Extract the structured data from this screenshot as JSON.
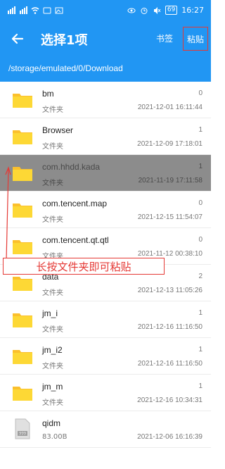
{
  "status_bar": {
    "time": "16:27",
    "battery": "69"
  },
  "app_bar": {
    "title": "选择1项",
    "bookmark_label": "书签",
    "paste_label": "粘贴"
  },
  "path": "/storage/emulated/0/Download",
  "annotation": "长按文件夹即可粘贴",
  "files": [
    {
      "name": "bm",
      "type": "文件夹",
      "count": "0",
      "date": "2021-12-01 16:11:44",
      "selected": false,
      "kind": "folder"
    },
    {
      "name": "Browser",
      "type": "文件夹",
      "count": "1",
      "date": "2021-12-09 17:18:01",
      "selected": false,
      "kind": "folder"
    },
    {
      "name": "com.hhdd.kada",
      "type": "文件夹",
      "count": "1",
      "date": "2021-11-19 17:11:58",
      "selected": true,
      "kind": "folder"
    },
    {
      "name": "com.tencent.map",
      "type": "文件夹",
      "count": "0",
      "date": "2021-12-15 11:54:07",
      "selected": false,
      "kind": "folder"
    },
    {
      "name": "com.tencent.qt.qtl",
      "type": "文件夹",
      "count": "0",
      "date": "2021-11-12 00:38:10",
      "selected": false,
      "kind": "folder"
    },
    {
      "name": "data",
      "type": "文件夹",
      "count": "2",
      "date": "2021-12-13 11:05:26",
      "selected": false,
      "kind": "folder"
    },
    {
      "name": "jm_i",
      "type": "文件夹",
      "count": "1",
      "date": "2021-12-16 11:16:50",
      "selected": false,
      "kind": "folder"
    },
    {
      "name": "jm_i2",
      "type": "文件夹",
      "count": "1",
      "date": "2021-12-16 11:16:50",
      "selected": false,
      "kind": "folder"
    },
    {
      "name": "jm_m",
      "type": "文件夹",
      "count": "1",
      "date": "2021-12-16 10:34:31",
      "selected": false,
      "kind": "folder"
    },
    {
      "name": "qidm",
      "type": "83.00B",
      "count": "",
      "date": "2021-12-06 16:16:39",
      "selected": false,
      "kind": "file"
    }
  ],
  "colors": {
    "primary": "#2196f3",
    "folder": "#fbc02d",
    "annotation": "#e53935"
  }
}
